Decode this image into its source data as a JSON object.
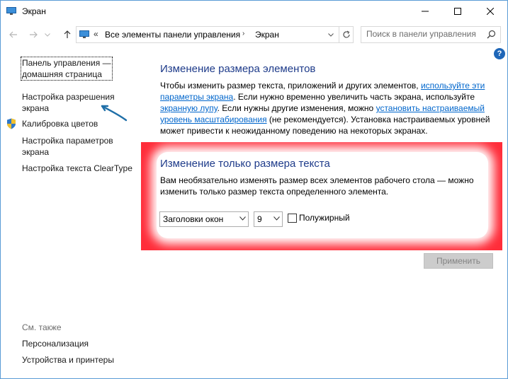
{
  "window": {
    "title": "Экран"
  },
  "address": {
    "overflow": "«",
    "crumb1": "Все элементы панели управления",
    "separator": "›",
    "crumb2": "Экран"
  },
  "search": {
    "placeholder": "Поиск в панели управления"
  },
  "help": {
    "label": "?"
  },
  "sidebar": {
    "home_line1": "Панель управления —",
    "home_line2": "домашняя страница",
    "items": [
      {
        "line1": "Настройка разрешения",
        "line2": "экрана"
      },
      {
        "line1": "Калибровка цветов",
        "line2": ""
      },
      {
        "line1": "Настройка параметров",
        "line2": "экрана"
      },
      {
        "line1": "Настройка текста ClearType",
        "line2": ""
      }
    ],
    "see_also": "См. также",
    "see_also_items": [
      "Персонализация",
      "Устройства и принтеры"
    ]
  },
  "main": {
    "heading": "Изменение размера элементов",
    "para": {
      "t1": "Чтобы изменить размер текста, приложений и других элементов, ",
      "l1": "используйте эти параметры экрана",
      "t2": ". Если нужно временно увеличить часть экрана, используйте ",
      "l2": "экранную лупу",
      "t3": ". Если нужны другие изменения, можно ",
      "l3": "установить настраиваемый уровень масштабирования",
      "t4": " (не рекомендуется). Установка настраиваемых уровней может привести к неожиданному поведению на некоторых экранах."
    },
    "text_heading": "Изменение только размера текста",
    "text_para": "Вам необязательно изменять размер всех элементов рабочего стола — можно изменить только размер текста определенного элемента.",
    "element_select": "Заголовки окон",
    "size_select": "9",
    "bold_label": "Полужирный",
    "apply": "Применить"
  },
  "colors": {
    "accent": "#1e3b8a",
    "link": "#0066cc",
    "highlight": "#ff2d3a",
    "arrow": "#1f6fa8"
  }
}
